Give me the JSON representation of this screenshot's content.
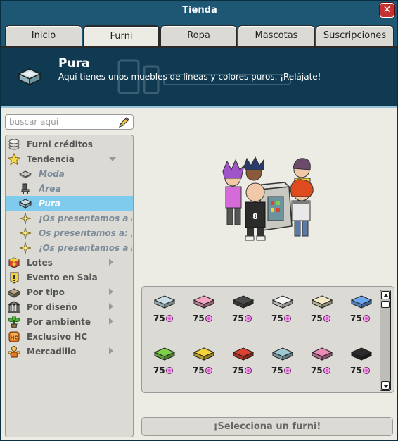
{
  "window": {
    "title": "Tienda",
    "close_label": "✕"
  },
  "tabs": [
    {
      "label": "Inicio"
    },
    {
      "label": "Furni",
      "active": true
    },
    {
      "label": "Ropa"
    },
    {
      "label": "Mascotas"
    },
    {
      "label": "Suscripciones"
    }
  ],
  "header": {
    "title": "Pura",
    "description": "Aquí tienes unos muebles de líneas y colores puros. ¡Relájate!",
    "icon": "pura-sofa-icon"
  },
  "search": {
    "placeholder": "buscar aquí",
    "value": ""
  },
  "categories": [
    {
      "label": "Furni créditos",
      "icon": "credits-stack-icon"
    },
    {
      "label": "Tendencia",
      "icon": "star-icon",
      "expanded": true
    },
    {
      "label": "Moda",
      "icon": "rug-icon"
    },
    {
      "label": "Área",
      "icon": "chair-icon"
    },
    {
      "label": "Pura",
      "icon": "pura-sofa-icon",
      "selected": true
    },
    {
      "label": "¡Os presentamos a Los T",
      "icon": "sparkle-icon"
    },
    {
      "label": "Os presentamos a: ¡Hell",
      "icon": "sparkle-icon"
    },
    {
      "label": "¡Os presentamos a My M",
      "icon": "sparkle-icon"
    },
    {
      "label": "Lotes",
      "icon": "lotes-box-icon"
    },
    {
      "label": "Evento en Sala",
      "icon": "event-flag-icon"
    },
    {
      "label": "Por tipo",
      "icon": "type-icon"
    },
    {
      "label": "Por diseño",
      "icon": "columns-icon"
    },
    {
      "label": "Por ambiente",
      "icon": "plant-icon"
    },
    {
      "label": "Exclusivo HC",
      "icon": "hc-icon"
    },
    {
      "label": "Mercadillo",
      "icon": "market-icon"
    }
  ],
  "items": [
    {
      "price": "75",
      "color": "#c7dde3"
    },
    {
      "price": "75",
      "color": "#f3a6c4"
    },
    {
      "price": "75",
      "color": "#4a4a4a"
    },
    {
      "price": "75",
      "color": "#f5f5f5"
    },
    {
      "price": "75",
      "color": "#f3e9c4"
    },
    {
      "price": "75",
      "color": "#6ca8f0"
    },
    {
      "price": "75",
      "color": "#7ecf4a"
    },
    {
      "price": "75",
      "color": "#f3d23a"
    },
    {
      "price": "75",
      "color": "#d9432f"
    },
    {
      "price": "75",
      "color": "#9ec9d3"
    },
    {
      "price": "75",
      "color": "#e98bb4"
    },
    {
      "price": "75",
      "color": "#2b2b2b"
    }
  ],
  "footer": {
    "select_label": "¡Selecciona un furni!"
  },
  "colors": {
    "titlebar": "#1d5774",
    "header_bg": "#0f3a52",
    "selected_row": "#7ecbed",
    "coin": "#d85bd0"
  }
}
